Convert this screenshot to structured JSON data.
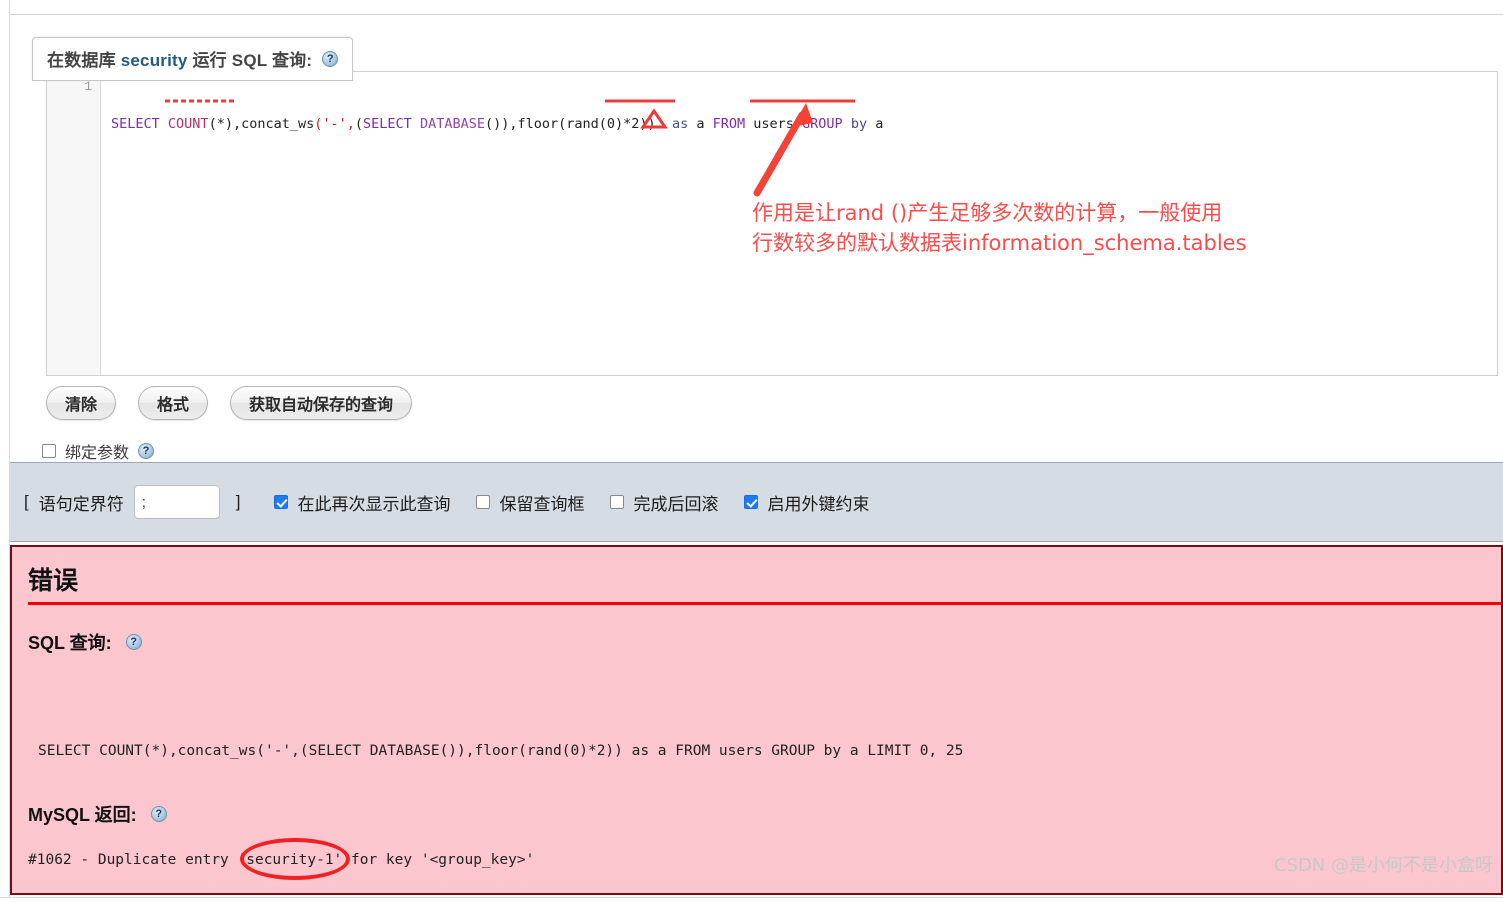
{
  "query_panel": {
    "legend_prefix": "在数据库 ",
    "legend_db": "security",
    "legend_suffix": " 运行 SQL 查询:",
    "help_icon": "help-icon",
    "editor": {
      "line_number": "1",
      "tokens": [
        {
          "t": "SELECT",
          "c": "kw"
        },
        {
          "t": " ",
          "c": "plain"
        },
        {
          "t": "COUNT",
          "c": "fn"
        },
        {
          "t": "(*),",
          "c": "plain"
        },
        {
          "t": "concat_ws",
          "c": "plain"
        },
        {
          "t": "('-',",
          "c": "str"
        },
        {
          "t": "(",
          "c": "plain"
        },
        {
          "t": "SELECT",
          "c": "kw"
        },
        {
          "t": " ",
          "c": "plain"
        },
        {
          "t": "DATABASE",
          "c": "kw2"
        },
        {
          "t": "()),",
          "c": "plain"
        },
        {
          "t": "floor",
          "c": "plain"
        },
        {
          "t": "(",
          "c": "plain"
        },
        {
          "t": "rand",
          "c": "plain"
        },
        {
          "t": "(0)*2))",
          "c": "plain"
        },
        {
          "t": "  ",
          "c": "plain"
        },
        {
          "t": "as",
          "c": "as"
        },
        {
          "t": " a ",
          "c": "plain"
        },
        {
          "t": "FROM",
          "c": "kw"
        },
        {
          "t": " ",
          "c": "plain"
        },
        {
          "t": "users",
          "c": "plain"
        },
        {
          "t": " ",
          "c": "plain"
        },
        {
          "t": "GROUP",
          "c": "kw"
        },
        {
          "t": " ",
          "c": "plain"
        },
        {
          "t": "by",
          "c": "as"
        },
        {
          "t": " a",
          "c": "plain"
        }
      ],
      "full_text": "SELECT COUNT(*),concat_ws('-',(SELECT DATABASE()),floor(rand(0)*2)) as a FROM users GROUP by a"
    },
    "annotation": {
      "text": "作用是让rand  ()产生足够多次数的计算，一般使用\n行数较多的默认数据表information_schema.tables",
      "color": "#fb4b4b"
    },
    "buttons": [
      {
        "name": "clear-button",
        "label": "清除"
      },
      {
        "name": "format-button",
        "label": "格式"
      },
      {
        "name": "get-autosaved-query-button",
        "label": "获取自动保存的查询"
      }
    ],
    "bind_params": {
      "label": "绑定参数",
      "checked": false,
      "help_icon": "help-icon"
    }
  },
  "option_bar": {
    "delimiter_open_bracket": "[",
    "delimiter_label": "语句定界符",
    "delimiter_value": ";",
    "delimiter_placeholder": "",
    "delimiter_close_bracket": "]",
    "options": [
      {
        "name": "show-query-again",
        "label": "在此再次显示此查询",
        "checked": true
      },
      {
        "name": "retain-query-box",
        "label": "保留查询框",
        "checked": false
      },
      {
        "name": "rollback-when-finished",
        "label": "完成后回滚",
        "checked": false
      },
      {
        "name": "enable-foreign-key-checks",
        "label": "启用外键约束",
        "checked": true
      }
    ]
  },
  "error_panel": {
    "title": "错误",
    "sql_query_label": "SQL 查询:",
    "sql_query_help_icon": "help-icon",
    "sql_query_text": "SELECT COUNT(*),concat_ws('-',(SELECT DATABASE()),floor(rand(0)*2)) as a FROM users GROUP by a LIMIT 0, 25",
    "mysql_return_label": "MySQL 返回:",
    "mysql_return_help_icon": "help-icon",
    "error_message": "#1062 - Duplicate entry 'security-1' for key '<group_key>'",
    "error_message_parts": {
      "before": "#1062 - Duplicate entry ",
      "highlighted": "'security-1'",
      "after": " for key '<group_key>'"
    },
    "background": "#fcc6ce",
    "border_color": "#7a0b15",
    "rule_color": "#f00000"
  },
  "watermark": "CSDN @是小何不是小盒呀"
}
